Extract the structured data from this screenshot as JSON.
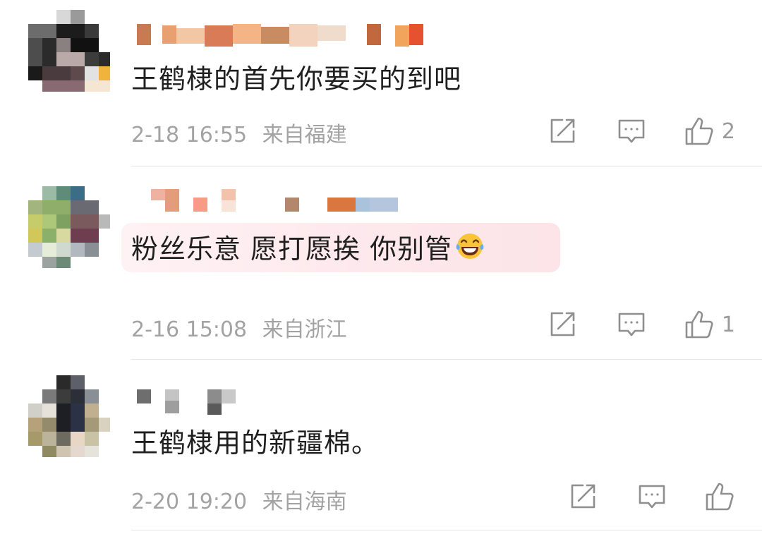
{
  "comments": [
    {
      "text": "王鹤棣的首先你要买的到吧",
      "time": "2-18 16:55",
      "location": "来自福建",
      "like_count": "2",
      "has_emoji": false
    },
    {
      "text": "粉丝乐意 愿打愿挨 你别管",
      "time": "2-16 15:08",
      "location": "来自浙江",
      "like_count": "1",
      "has_emoji": true,
      "emoji_name": "laughing-tears-emoji"
    },
    {
      "text": "王鹤棣用的新疆棉。",
      "time": "2-20 19:20",
      "location": "来自海南",
      "like_count": "",
      "has_emoji": false
    }
  ],
  "icons": {
    "share": "share-icon",
    "reply": "comment-icon",
    "like": "thumbs-up-icon"
  },
  "colors": {
    "text": "#1f1f1f",
    "meta": "#a3a3a3",
    "icon": "#8f8f8f",
    "highlight": "#fde8ec",
    "divider": "#e6e6e6"
  }
}
